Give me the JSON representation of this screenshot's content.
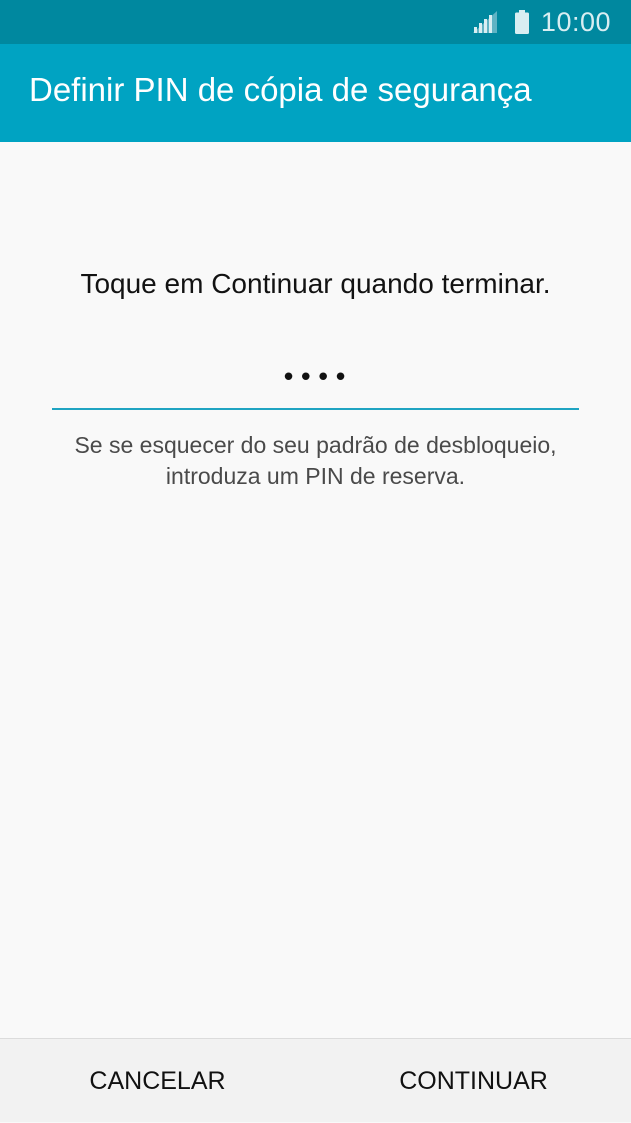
{
  "status_bar": {
    "time": "10:00",
    "icons": [
      "signal-icon",
      "battery-icon"
    ]
  },
  "app_bar": {
    "title": "Definir PIN de cópia de segurança"
  },
  "main": {
    "prompt": "Toque em Continuar quando terminar.",
    "pin_value": "••••",
    "hint": "Se se esquecer do seu padrão de desbloqueio, introduza um PIN de reserva."
  },
  "bottom_bar": {
    "cancel_label": "CANCELAR",
    "continue_label": "CONTINUAR"
  },
  "colors": {
    "status_bar": "#00889f",
    "app_bar": "#00a3c2",
    "accent_underline": "#1fa4c2",
    "background": "#f9f9f9"
  }
}
